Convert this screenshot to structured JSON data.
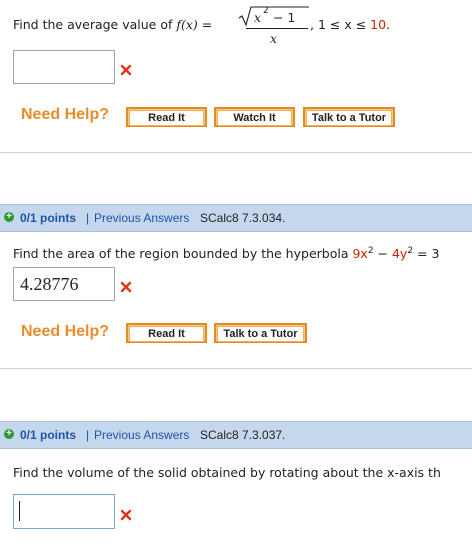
{
  "q1": {
    "prefix": "Find the average value of ",
    "fx": "f(x)",
    "equals": " = ",
    "radicand_base": "x",
    "radicand_exp": "2",
    "radicand_rest": " − 1",
    "denominator": "x",
    "interval_pre": ", 1 ≤ x ≤ ",
    "interval_end": "10",
    "interval_dot": ".",
    "answer_value": "",
    "status_icon": "cross-icon"
  },
  "help1": {
    "label": "Need Help?",
    "buttons": [
      "Read It",
      "Watch It",
      "Talk to a Tutor"
    ]
  },
  "q2": {
    "header": {
      "points": "0/1 points",
      "sep": "|",
      "previous": "Previous Answers",
      "code": "SCalc8 7.3.034."
    },
    "prefix": "Find the area of the region bounded by the hyperbola ",
    "eq_a": "9x",
    "exp1": "2",
    "minus": " − ",
    "eq_b": "4y",
    "exp2": "2",
    "eq_rest": " = 3",
    "answer_value": "4.28776",
    "status_icon": "cross-icon"
  },
  "help2": {
    "label": "Need Help?",
    "buttons": [
      "Read It",
      "Talk to a Tutor"
    ]
  },
  "q3": {
    "header": {
      "points": "0/1 points",
      "sep": "|",
      "previous": "Previous Answers",
      "code": "SCalc8 7.3.037."
    },
    "text": "Find the volume of the solid obtained by rotating about the x-axis th",
    "answer_value": "",
    "status_icon": "cross-icon"
  },
  "colors": {
    "accent_orange": "#e98c2c",
    "link_blue": "#1f55a8",
    "error_red": "#cc2200",
    "header_bg": "#c5d7ec"
  }
}
